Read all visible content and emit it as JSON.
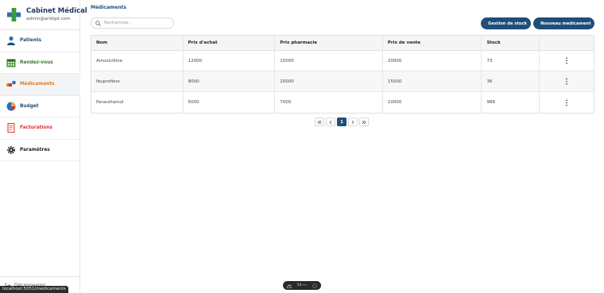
{
  "brand": {
    "title": "Cabinet Médical",
    "subtitle": "admin@arldigit.com"
  },
  "nav": [
    {
      "label": "Patients",
      "icon": "patients-icon",
      "color": "#1e4e79",
      "active": false
    },
    {
      "label": "Rendez-vous",
      "icon": "calendar-icon",
      "color": "#3a7d2c",
      "active": false
    },
    {
      "label": "Médicaments",
      "icon": "medicine-icon",
      "color": "#e07b20",
      "active": true
    },
    {
      "label": "Budget",
      "icon": "budget-icon",
      "color": "#1e4e79",
      "active": false
    },
    {
      "label": "Facturations",
      "icon": "invoice-icon",
      "color": "#d9342b",
      "active": false
    },
    {
      "label": "Paramètres",
      "icon": "gear-icon",
      "color": "#222222",
      "active": false
    }
  ],
  "logout_label": "Déconnexion",
  "status_url": "localhost:5051/medicaments",
  "page_title": "Médicaments",
  "search": {
    "placeholder": "Rechercher..."
  },
  "buttons": {
    "stock": "Gestion de stock",
    "new": "Nouveau medicament"
  },
  "table": {
    "headers": [
      "Nom",
      "Prix d'achat",
      "Prix pharmacie",
      "Prix de vente",
      "Stock",
      ""
    ],
    "rows": [
      [
        "Amoxicilline",
        "12000",
        "15000",
        "20000",
        "73"
      ],
      [
        "Ibuprofène",
        "8000",
        "10000",
        "15000",
        "36"
      ],
      [
        "Paracétamol",
        "5000",
        "7000",
        "10000",
        "988"
      ]
    ]
  },
  "pagination": {
    "current_page": "1"
  },
  "float_toolbar": {
    "value": "54",
    "unit": "ms"
  },
  "colors": {
    "primary": "#1f4e79",
    "active_nav": "#e07b20"
  }
}
